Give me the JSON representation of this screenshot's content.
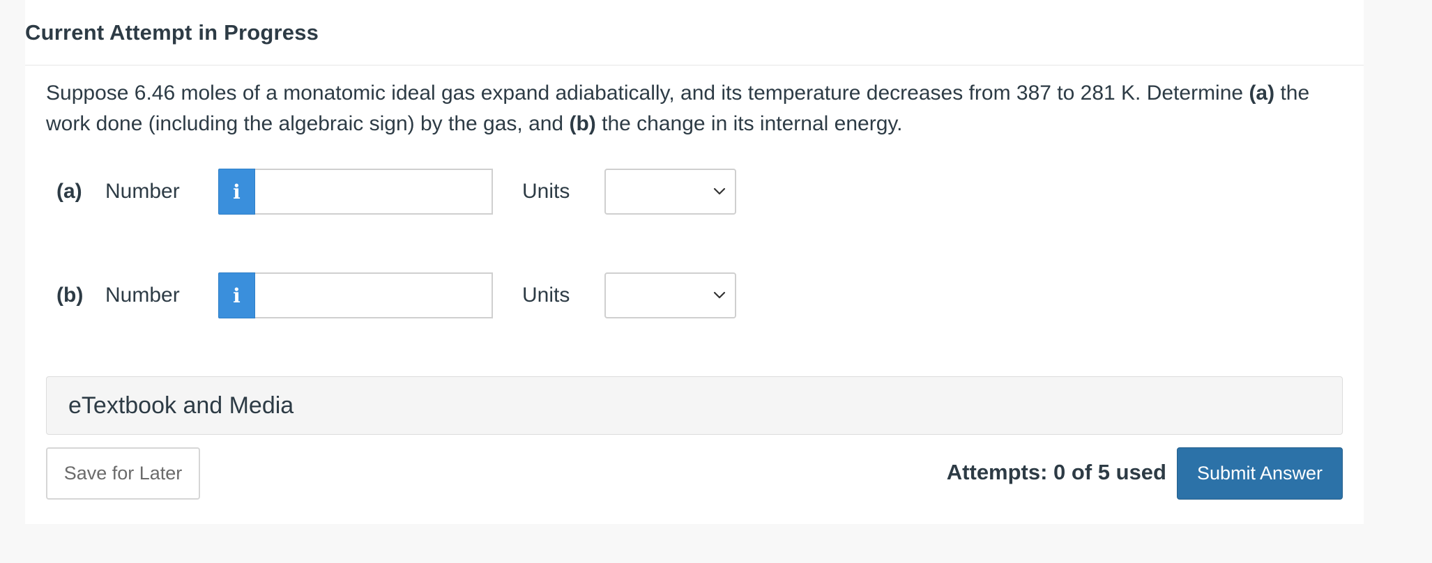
{
  "header": {
    "title": "Current Attempt in Progress"
  },
  "question": {
    "text_1": "Suppose 6.46 moles of a monatomic ideal gas expand adiabatically, and its temperature decreases from 387 to 281 K. Determine ",
    "part_a_marker": "(a)",
    "text_2": " the work done (including the algebraic sign) by the gas, and ",
    "part_b_marker": "(b)",
    "text_3": " the change in its internal energy."
  },
  "parts": [
    {
      "label": "(a)",
      "number_label": "Number",
      "info_icon": "i",
      "value": "",
      "units_label": "Units",
      "units_selected": ""
    },
    {
      "label": "(b)",
      "number_label": "Number",
      "info_icon": "i",
      "value": "",
      "units_label": "Units",
      "units_selected": ""
    }
  ],
  "etextbook": {
    "label": "eTextbook and Media"
  },
  "footer": {
    "save_label": "Save for Later",
    "attempts_text": "Attempts: 0 of 5 used",
    "submit_label": "Submit Answer"
  },
  "colors": {
    "info_blue": "#3a8fdc",
    "submit_blue": "#2c72a8",
    "text": "#2d3b45"
  }
}
